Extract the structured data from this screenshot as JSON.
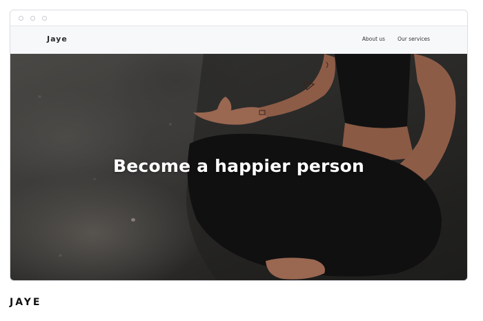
{
  "site": {
    "brand": "Jaye",
    "nav": [
      {
        "label": "About us"
      },
      {
        "label": "Our services"
      }
    ]
  },
  "hero": {
    "title": "Become a happier person"
  },
  "caption": "JAYE"
}
